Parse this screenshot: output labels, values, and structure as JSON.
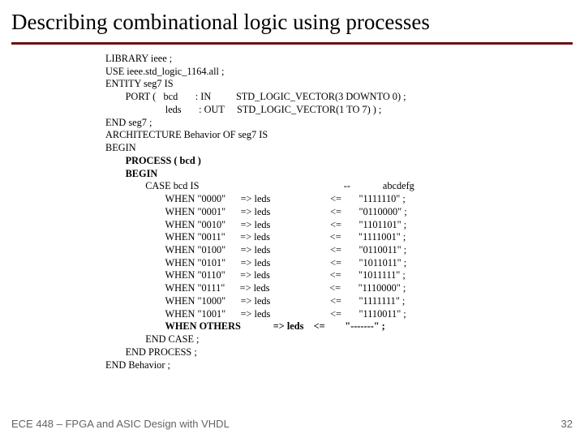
{
  "title": "Describing combinational logic using processes",
  "code": {
    "l1": "LIBRARY ieee ;",
    "l2": "USE ieee.std_logic_1164.all ;",
    "l3": "ENTITY seg7 IS",
    "l4": "        PORT (   bcd       : IN          STD_LOGIC_VECTOR(3 DOWNTO 0) ;",
    "l5": "                        leds       : OUT     STD_LOGIC_VECTOR(1 TO 7) ) ;",
    "l6": "END seg7 ;",
    "l7": "ARCHITECTURE Behavior OF seg7 IS",
    "l8": "BEGIN",
    "l9a": "        PROCESS ( bcd )",
    "l9b": "        BEGIN",
    "l10": "                CASE bcd IS                                                          --             abcdefg",
    "l11": "                        WHEN \"0000\"      => leds                        <=       \"1111110\" ;",
    "l12": "                        WHEN \"0001\"      => leds                        <=       \"0110000\" ;",
    "l13": "                        WHEN \"0010\"      => leds                        <=       \"1101101\" ;",
    "l14": "                        WHEN \"0011\"      => leds                        <=       \"1111001\" ;",
    "l15": "                        WHEN \"0100\"      => leds                        <=       \"0110011\" ;",
    "l16": "                        WHEN \"0101\"      => leds                        <=       \"1011011\" ;",
    "l17": "                        WHEN \"0110\"      => leds                        <=       \"1011111\" ;",
    "l18": "                        WHEN \"0111\"      => leds                        <=       \"1110000\" ;",
    "l19": "                        WHEN \"1000\"      => leds                        <=       \"1111111\" ;",
    "l20": "                        WHEN \"1001\"      => leds                        <=       \"1110011\" ;",
    "l21a": "                        WHEN OTHERS             => leds    <=       ",
    "l21b": " \"-------\" ;",
    "l22": "                END CASE ;",
    "l23": "        END PROCESS ;",
    "l24": "END Behavior ;"
  },
  "footer": {
    "left": "ECE 448 – FPGA and ASIC Design with VHDL",
    "right": "32"
  },
  "chart_data": {
    "type": "table",
    "title": "seg7 CASE statement: bcd input to leds output",
    "columns": [
      "bcd",
      "leds (abcdefg)"
    ],
    "rows": [
      [
        "0000",
        "1111110"
      ],
      [
        "0001",
        "0110000"
      ],
      [
        "0010",
        "1101101"
      ],
      [
        "0011",
        "1111001"
      ],
      [
        "0100",
        "0110011"
      ],
      [
        "0101",
        "1011011"
      ],
      [
        "0110",
        "1011111"
      ],
      [
        "0111",
        "1110000"
      ],
      [
        "1000",
        "1111111"
      ],
      [
        "1001",
        "1110011"
      ],
      [
        "OTHERS",
        "-------"
      ]
    ]
  }
}
